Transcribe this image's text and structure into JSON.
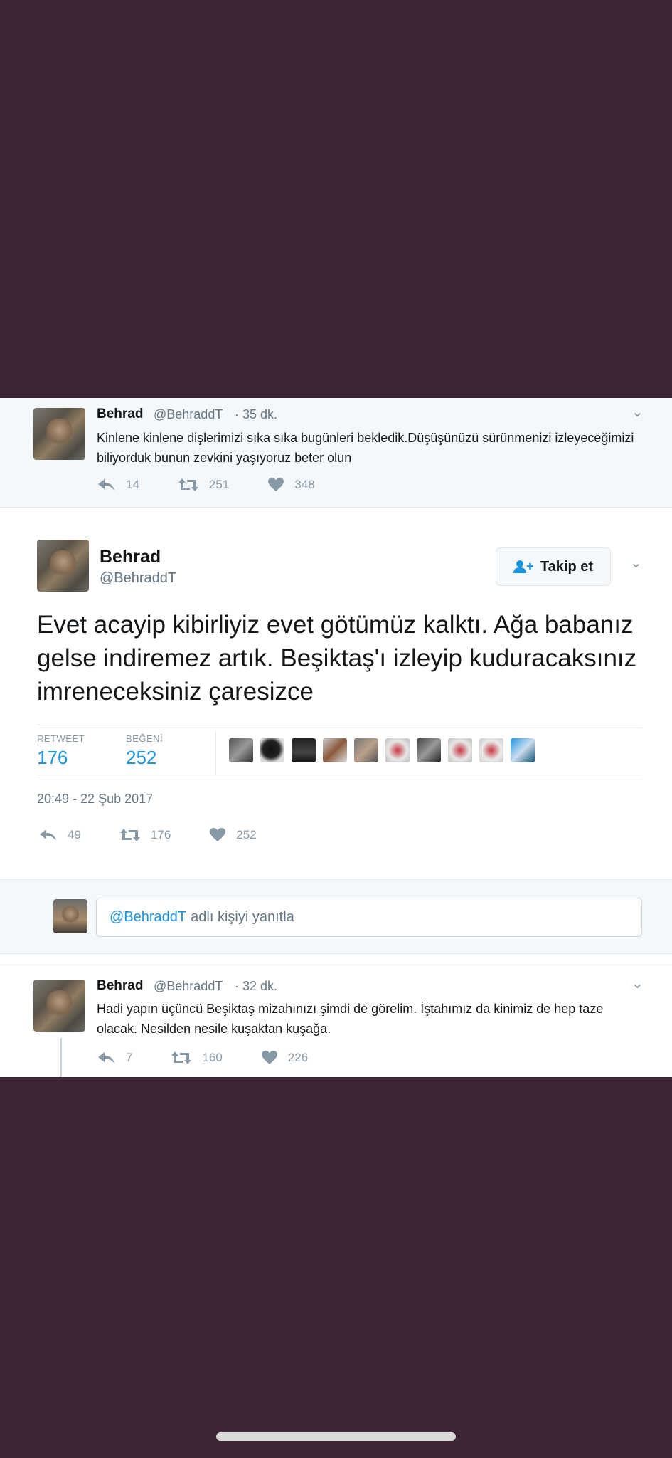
{
  "tweet_prev": {
    "name": "Behrad",
    "handle": "@BehraddT",
    "time": "· 35 dk.",
    "text": "Kinlene kinlene dişlerimizi sıka sıka bugünleri bekledik.Düşüşünüzü sürünmenizi izleyeceğimizi biliyorduk bunun zevkini yaşıyoruz beter olun",
    "replies": "14",
    "retweets": "251",
    "likes": "348"
  },
  "tweet_main": {
    "name": "Behrad",
    "handle": "@BehraddT",
    "follow_label": "Takip et",
    "text": "Evet acayip kibirliyiz evet götümüz kalktı. Ağa babanız gelse indiremez artık. Beşiktaş'ı izleyip kuduracaksınız imreneceksiniz çaresizce",
    "retweet_label": "RETWEET",
    "retweet_count": "176",
    "like_label": "BEĞENİ",
    "like_count": "252",
    "date": "20:49 - 22 Şub 2017",
    "replies": "49",
    "retweets": "176",
    "likes": "252"
  },
  "reply": {
    "mention": "@BehraddT",
    "placeholder": "adlı kişiyi yanıtla"
  },
  "tweet_next": {
    "name": "Behrad",
    "handle": "@BehraddT",
    "time": "· 32 dk.",
    "text": "Hadi yapın üçüncü Beşiktaş mizahınızı şimdi de görelim. İştahımız da kinimiz de hep taze olacak. Nesilden nesile kuşaktan kuşağa.",
    "replies": "7",
    "retweets": "160",
    "likes": "226"
  },
  "colors": {
    "background": "#3c2637",
    "link_blue": "#1b95e0",
    "muted": "#8899a6"
  }
}
